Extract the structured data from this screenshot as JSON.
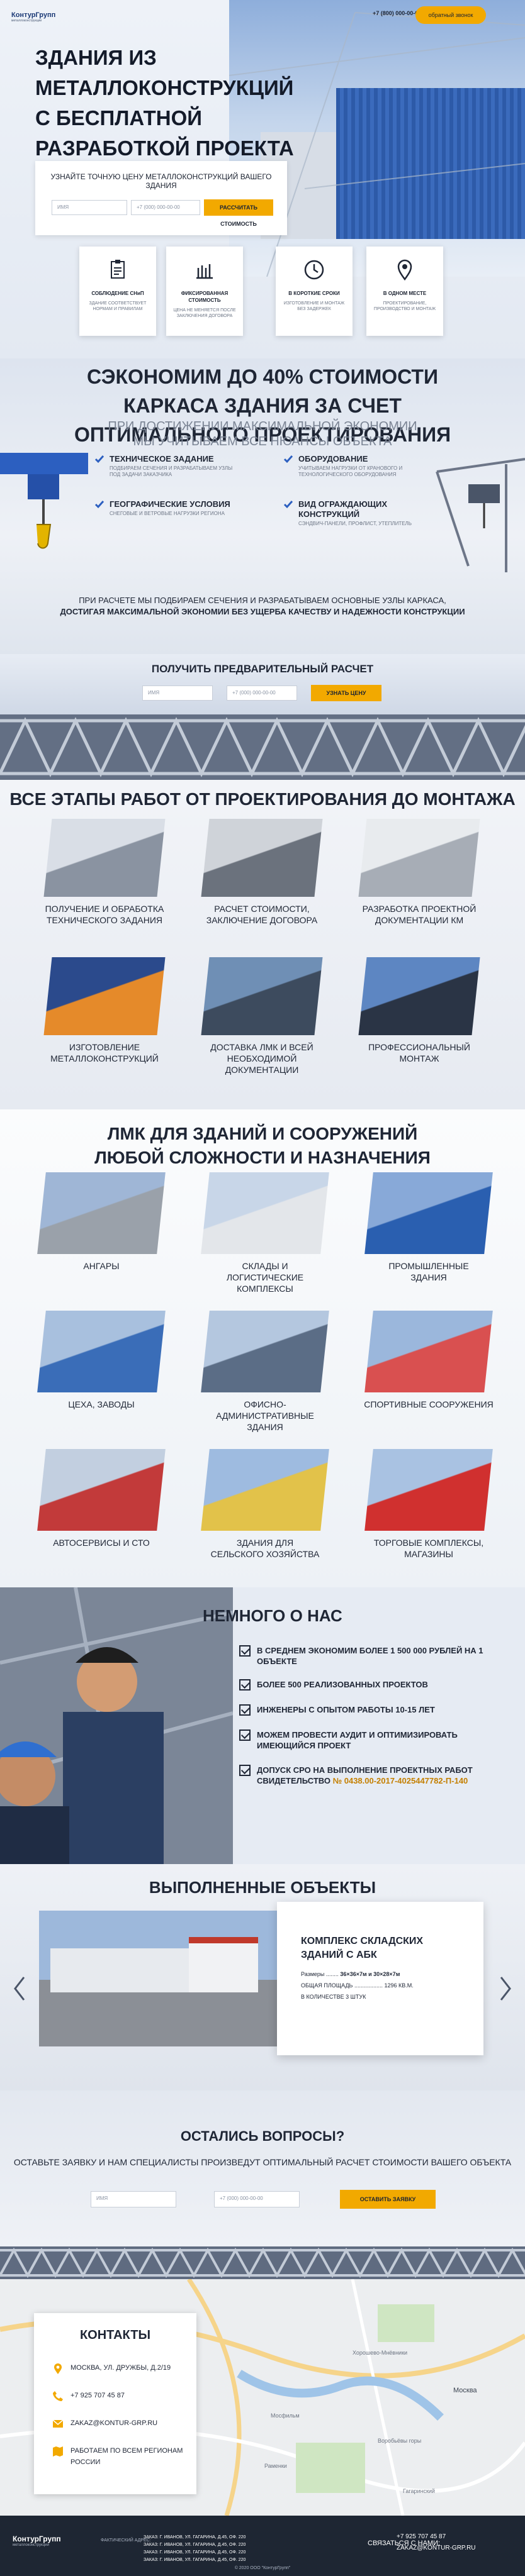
{
  "brand": {
    "name": "КонтурГрупп",
    "tagline": "металлоконструкции",
    "accent": "#f2a900",
    "dark": "#1e2633"
  },
  "header": {
    "phone": "+7 (800) 000-00-00",
    "callback_label": "обратный звонок"
  },
  "hero": {
    "title": "ЗДАНИЯ ИЗ МЕТАЛЛОКОНСТРУКЦИЙ С БЕСПЛАТНОЙ РАЗРАБОТКОЙ ПРОЕКТА КМ",
    "form_title": "УЗНАЙТЕ ТОЧНУЮ ЦЕНУ МЕТАЛЛОКОНСТРУКЦИЙ ВАШЕГО ЗДАНИЯ",
    "name_placeholder": "ИМЯ",
    "phone_placeholder": "+7 (000) 000-00-00",
    "submit_label": "РАССЧИТАТЬ СТОИМОСТЬ",
    "features": [
      {
        "icon": "clipboard-icon",
        "title": "СОБЛЮДЕНИЕ СНиП",
        "text": "ЗДАНИЕ СООТВЕТСТВУЕТ НОРМАМ И ПРАВИЛАМ"
      },
      {
        "icon": "calculator-icon",
        "title": "ФИКСИРОВАННАЯ СТОИМОСТЬ",
        "text": "ЦЕНА НЕ МЕНЯЕТСЯ ПОСЛЕ ЗАКЛЮЧЕНИЯ ДОГОВОРА"
      },
      {
        "icon": "clock-icon",
        "title": "В КОРОТКИЕ СРОКИ",
        "text": "ИЗГОТОВЛЕНИЕ И МОНТАЖ БЕЗ ЗАДЕРЖЕК"
      },
      {
        "icon": "location-pin-icon",
        "title": "В ОДНОМ МЕСТЕ",
        "text": "ПРОЕКТИРОВАНИЕ, ПРОИЗВОДСТВО И МОНТАЖ"
      }
    ]
  },
  "save": {
    "title": "СЭКОНОМИМ ДО 40% СТОИМОСТИ КАРКАСА ЗДАНИЯ ЗА СЧЕТ ОПТИМАЛЬНОГО ПРОЕКТИРОВАНИЯ",
    "subtitle": "ПРИ ДОСТИЖЕНИИ МАКСИМАЛЬНОЙ ЭКОНОМИИ МЫ УЧИТЫВАЕМ ВСЕ НЮАНСЫ ОБЪЕКТА",
    "items": [
      {
        "title": "ТЕХНИЧЕСКОЕ ЗАДАНИЕ",
        "text": "ПОДБИРАЕМ СЕЧЕНИЯ И РАЗРАБАТЫВАЕМ УЗЛЫ ПОД ЗАДАЧИ ЗАКАЗЧИКА"
      },
      {
        "title": "ОБОРУДОВАНИЕ",
        "text": "УЧИТЫВАЕМ НАГРУЗКИ ОТ КРАНОВОГО И ТЕХНОЛОГИЧЕСКОГО ОБОРУДОВАНИЯ"
      },
      {
        "title": "ГЕОГРАФИЧЕСКИЕ УСЛОВИЯ",
        "text": "СНЕГОВЫЕ И ВЕТРОВЫЕ НАГРУЗКИ РЕГИОНА"
      },
      {
        "title": "ВИД ОГРАЖДАЮЩИХ КОНСТРУКЦИЙ",
        "text": "СЭНДВИЧ-ПАНЕЛИ, ПРОФЛИСТ, УТЕПЛИТЕЛЬ"
      }
    ],
    "para1": "ПРИ РАСЧЕТЕ МЫ ПОДБИРАЕМ СЕЧЕНИЯ И РАЗРАБАТЫВАЕМ ОСНОВНЫЕ УЗЛЫ КАРКАСА,",
    "para2": "ДОСТИГАЯ МАКСИМАЛЬНОЙ ЭКОНОМИИ БЕЗ УЩЕРБА КАЧЕСТВУ И НАДЕЖНОСТИ КОНСТРУКЦИИ"
  },
  "calc": {
    "title": "ПОЛУЧИТЬ ПРЕДВАРИТЕЛЬНЫЙ РАСЧЕТ",
    "name_placeholder": "ИМЯ",
    "phone_placeholder": "+7 (000) 000-00-00",
    "submit_label": "УЗНАТЬ ЦЕНУ"
  },
  "stages": {
    "title": "ВСЕ ЭТАПЫ РАБОТ ОТ ПРОЕКТИРОВАНИЯ ДО МОНТАЖА",
    "items": [
      {
        "l1": "ПОЛУЧЕНИЕ И ОБРАБОТКА",
        "l2": "ТЕХНИЧЕСКОГО ЗАДАНИЯ",
        "c1": "#d9dee6",
        "c2": "#8a93a1"
      },
      {
        "l1": "РАСЧЕТ СТОИМОСТИ,",
        "l2": "ЗАКЛЮЧЕНИЕ ДОГОВОРА",
        "c1": "#cfd3d9",
        "c2": "#6b727d"
      },
      {
        "l1": "РАЗРАБОТКА ПРОЕКТНОЙ",
        "l2": "ДОКУМЕНТАЦИИ КМ",
        "c1": "#e8ebee",
        "c2": "#a7adb6"
      },
      {
        "l1": "ИЗГОТОВЛЕНИЕ",
        "l2": "МЕТАЛЛОКОНСТРУКЦИЙ",
        "c1": "#2b4a8c",
        "c2": "#e58a2a"
      },
      {
        "l1": "ДОСТАВКА ЛМК И ВСЕЙ",
        "l2": "НЕОБХОДИМОЙ ДОКУМЕНТАЦИИ",
        "c1": "#6f8fb5",
        "c2": "#3d4b5e"
      },
      {
        "l1": "ПРОФЕССИОНАЛЬНЫЙ",
        "l2": "МОНТАЖ",
        "c1": "#5d86c2",
        "c2": "#2a3445"
      }
    ]
  },
  "lmk": {
    "title1": "ЛМК ДЛЯ ЗДАНИЙ И СООРУЖЕНИЙ",
    "title2": "ЛЮБОЙ СЛОЖНОСТИ И НАЗНАЧЕНИЯ",
    "items": [
      {
        "l1": "АНГАРЫ",
        "l2": "",
        "c1": "#9fb6d6",
        "c2": "#9aa1aa"
      },
      {
        "l1": "СКЛАДЫ И",
        "l2": "ЛОГИСТИЧЕСКИЕ КОМПЛЕКСЫ",
        "c1": "#c8d6e8",
        "c2": "#e3e6ea"
      },
      {
        "l1": "ПРОМЫШЛЕННЫЕ",
        "l2": "ЗДАНИЯ",
        "c1": "#88a9d8",
        "c2": "#2a5fb0"
      },
      {
        "l1": "ЦЕХА, ЗАВОДЫ",
        "l2": "",
        "c1": "#a8c0de",
        "c2": "#3a6db8"
      },
      {
        "l1": "ОФИСНО-АДМИНИСТРАТИВНЫЕ",
        "l2": "ЗДАНИЯ",
        "c1": "#b4c7df",
        "c2": "#5b6d86"
      },
      {
        "l1": "СПОРТИВНЫЕ СООРУЖЕНИЯ",
        "l2": "",
        "c1": "#9bb7dc",
        "c2": "#d95050"
      },
      {
        "l1": "АВТОСЕРВИСЫ И СТО",
        "l2": "",
        "c1": "#c2cfe0",
        "c2": "#c23a3a"
      },
      {
        "l1": "ЗДАНИЯ ДЛЯ",
        "l2": "СЕЛЬСКОГО ХОЗЯЙСТВА",
        "c1": "#9ebbe0",
        "c2": "#e2c24a"
      },
      {
        "l1": "ТОРГОВЫЕ КОМПЛЕКСЫ,",
        "l2": "МАГАЗИНЫ",
        "c1": "#a9c2e2",
        "c2": "#d0302f"
      }
    ]
  },
  "about": {
    "title": "НЕМНОГО О НАС",
    "items": [
      "В СРЕДНЕМ ЭКОНОМИМ БОЛЕЕ 1 500 000 РУБЛЕЙ НА 1 ОБЪЕКТЕ",
      "БОЛЕЕ 500 РЕАЛИЗОВАННЫХ ПРОЕКТОВ",
      "ИНЖЕНЕРЫ С ОПЫТОМ РАБОТЫ 10-15 ЛЕТ",
      "МОЖЕМ ПРОВЕСТИ АУДИТ И ОПТИМИЗИРОВАТЬ ИМЕЮЩИЙСЯ ПРОЕКТ",
      "ДОПУСК СРО НА ВЫПОЛНЕНИЕ ПРОЕКТНЫХ РАБОТ"
    ],
    "cert_label": "СВИДЕТЕЛЬСТВО",
    "cert_link": "№ 0438.00-2017-4025447782-П-140"
  },
  "done": {
    "title": "ВЫПОЛНЕННЫЕ ОБЪЕКТЫ",
    "project_title": "КОМПЛЕКС СКЛАДСКИХ ЗДАНИЙ С АБК",
    "size_label": "Размеры",
    "size_value": "36×36×7м и 30×28×7м",
    "area_label": "ОБЩАЯ ПЛОЩАДЬ",
    "area_value": "1296 КВ.М.",
    "count_label": "В КОЛИЧЕСТВЕ 3 ШТУК"
  },
  "quest": {
    "title": "ОСТАЛИСЬ ВОПРОСЫ?",
    "subtitle": "ОСТАВЬТЕ ЗАЯВКУ И НАМ СПЕЦИАЛИСТЫ ПРОИЗВЕДУТ ОПТИМАЛЬНЫЙ РАСЧЕТ СТОИМОСТИ ВАШЕГО ОБЪЕКТА",
    "name_placeholder": "ИМЯ",
    "phone_placeholder": "+7 (000) 000-00-00",
    "submit_label": "ОСТАВИТЬ ЗАЯВКУ"
  },
  "contacts": {
    "title": "КОНТАКТЫ",
    "address": "МОСКВА, УЛ. ДРУЖБЫ, Д.2/19",
    "phone": "+7 925 707 45 87",
    "email": "ZAKAZ@KONTUR-GRP.RU",
    "region": "РАБОТАЕМ ПО ВСЕМ РЕГИОНАМ РОССИИ",
    "map_labels": [
      "Хорошево-Мнёвники",
      "Мосфильм",
      "Москва",
      "Раменки",
      "Воробьёвы горы",
      "Гагаринский"
    ]
  },
  "footer": {
    "addr_label": "ФАКТИЧЕСКИЙ АДРЕС:",
    "addr1": "ЗАКАЗ: Г. ИВАНОВ, УЛ. ГАГАРИНА, Д.45, ОФ. 220",
    "addr2": "ЗАКАЗ: Г. ИВАНОВ, УЛ. ГАГАРИНА, Д.45, ОФ. 220",
    "addr3": "ЗАКАЗ: Г. ИВАНОВ, УЛ. ГАГАРИНА, Д.45, ОФ. 220",
    "addr4": "ЗАКАЗ: Г. ИВАНОВ, УЛ. ГАГАРИНА, Д.45, ОФ. 220",
    "cta": "СВЯЗАТЬСЯ С НАМИ:",
    "phone": "+7 925 707 45 87",
    "email": "ZAKAZ@KONTUR-GRP.RU",
    "copyright": "© 2020 ООО \"КонтурГрупп\""
  }
}
